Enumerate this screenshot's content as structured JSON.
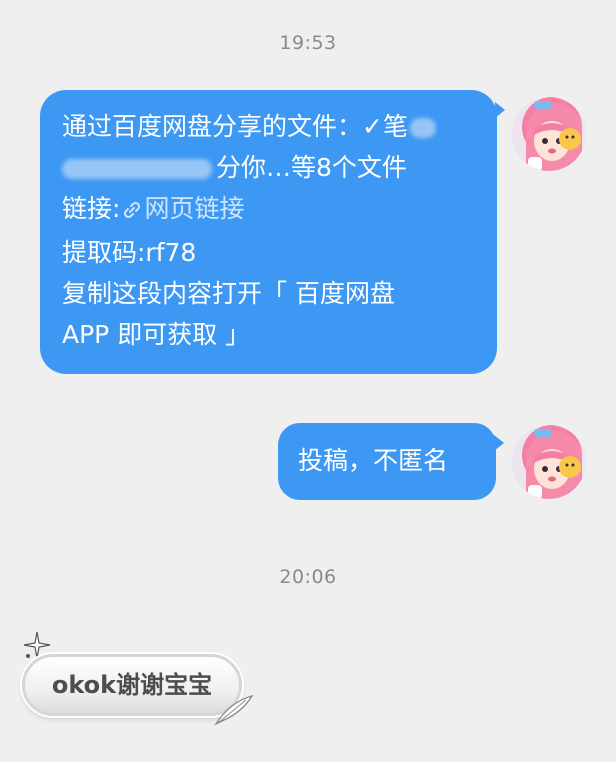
{
  "chat": {
    "timestamp_1": "19:53",
    "timestamp_2": "20:06",
    "message_1": {
      "line1_text": "通过百度网盘分享的文件：✓笔",
      "line2_text": "分你…等8个文件",
      "link_prefix": "链接:",
      "link_label": "网页链接",
      "code_line": "提取码:rf78",
      "line5": "复制这段内容打开「 百度网盘",
      "line6": "APP 即可获取 」"
    },
    "message_2": {
      "text": "投稿，不匿名"
    },
    "reply": {
      "text": "okok谢谢宝宝"
    }
  },
  "colors": {
    "sent_bubble": "#3d98f3",
    "background": "#efefef",
    "timestamp": "#8a8a8a"
  },
  "icons": {
    "avatar": "anime-girl-avatar",
    "link": "link-chain-icon",
    "sparkle": "sparkle-icon",
    "feather": "feather-icon"
  }
}
